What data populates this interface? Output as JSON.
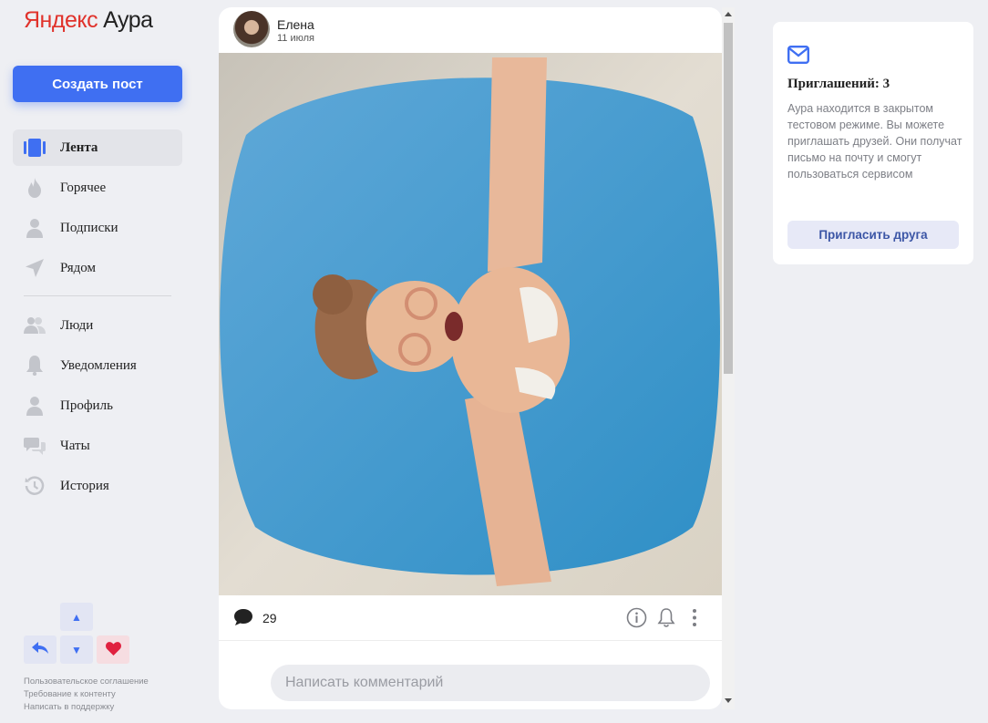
{
  "brand": {
    "yandex": "Яндекс",
    "product": "Аура",
    "accent": "#e0322b"
  },
  "sidebar": {
    "create_label": "Создать пост",
    "nav_primary": [
      {
        "label": "Лента",
        "icon": "feed-icon",
        "active": true
      },
      {
        "label": "Горячее",
        "icon": "fire-icon"
      },
      {
        "label": "Подписки",
        "icon": "person-icon"
      },
      {
        "label": "Рядом",
        "icon": "location-arrow-icon"
      }
    ],
    "nav_secondary": [
      {
        "label": "Люди",
        "icon": "people-icon"
      },
      {
        "label": "Уведомления",
        "icon": "bell-icon"
      },
      {
        "label": "Профиль",
        "icon": "person-icon"
      },
      {
        "label": "Чаты",
        "icon": "chat-icon"
      },
      {
        "label": "История",
        "icon": "history-icon"
      }
    ],
    "vote_pad": {
      "up": "▲",
      "down": "▼"
    },
    "footer_links": [
      "Пользовательское соглашение",
      "Требование к контенту",
      "Написать в поддержку"
    ]
  },
  "post": {
    "author": "Елена",
    "date": "11 июля",
    "comments_count": "29",
    "comment_placeholder": "Написать комментарий"
  },
  "invite": {
    "title": "Приглашений: 3",
    "text": "Аура находится в закрытом тестовом режиме. Вы можете приглашать друзей. Они получат письмо на почту и смогут пользоваться сервисом",
    "button_label": "Пригласить друга"
  },
  "colors": {
    "primary": "#3f6ff2",
    "background": "#eeeff3",
    "like": "#e0213f"
  }
}
